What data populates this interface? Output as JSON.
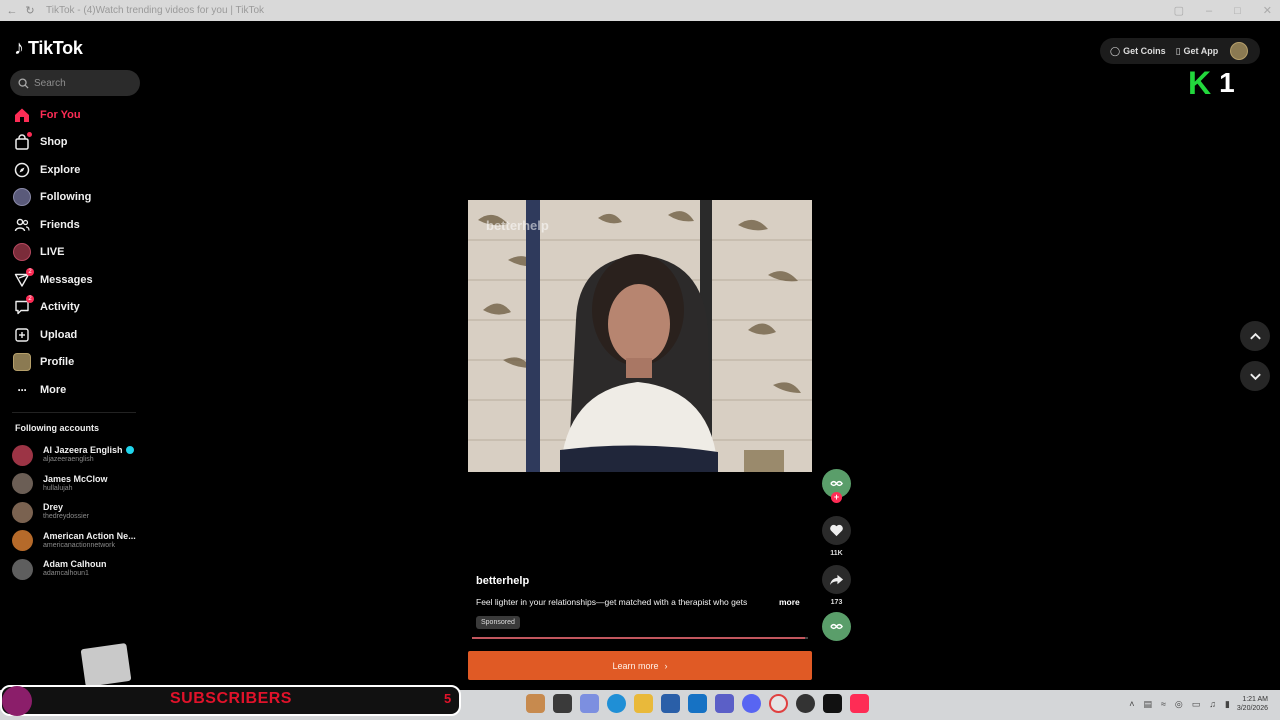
{
  "window": {
    "title": "TikTok - (4)Watch trending videos for you | TikTok"
  },
  "sidebar": {
    "logo_text": "TikTok",
    "search_placeholder": "Search",
    "items": [
      {
        "label": "For You",
        "icon": "home-icon",
        "active": true
      },
      {
        "label": "Shop",
        "icon": "shop-icon",
        "badge": ""
      },
      {
        "label": "Explore",
        "icon": "compass-icon"
      },
      {
        "label": "Following",
        "icon": "following-avatar-icon"
      },
      {
        "label": "Friends",
        "icon": "friends-icon"
      },
      {
        "label": "LIVE",
        "icon": "live-icon"
      },
      {
        "label": "Messages",
        "icon": "messages-icon",
        "badge": "2"
      },
      {
        "label": "Activity",
        "icon": "activity-icon",
        "badge": "2"
      },
      {
        "label": "Upload",
        "icon": "upload-icon"
      },
      {
        "label": "Profile",
        "icon": "profile-avatar-icon"
      },
      {
        "label": "More",
        "icon": "more-icon"
      }
    ],
    "following_header": "Following accounts",
    "accounts": [
      {
        "name": "Al Jazeera English",
        "handle": "aljazeeraenglish",
        "verified": true,
        "color": "#9c3445"
      },
      {
        "name": "James McClow",
        "handle": "hullalujah",
        "color": "#6b5e55"
      },
      {
        "name": "Drey",
        "handle": "thedreydossier",
        "color": "#7a6250"
      },
      {
        "name": "American Action Ne...",
        "handle": "americanactionnetwork",
        "color": "#b56a2a"
      },
      {
        "name": "Adam Calhoun",
        "handle": "adamcalhoun1",
        "color": "#5e5e5e"
      }
    ]
  },
  "topbar": {
    "get_coins": "Get Coins",
    "get_app": "Get App"
  },
  "overlay_counter": {
    "letter": "K",
    "number": "1"
  },
  "video": {
    "watermark": "betterhelp",
    "username": "betterhelp",
    "description": "Feel lighter in your relationships—get matched with a therapist who gets",
    "more_label": "more",
    "sponsored_label": "Sponsored",
    "cta_label": "Learn more",
    "progress": 0.99
  },
  "actions": {
    "likes": "11K",
    "shares": "173"
  },
  "stream_overlay": {
    "subscribers_label": "SUBSCRIBERS",
    "subscribers_count": "5"
  },
  "taskbar": {
    "time": "1:21 AM",
    "date": "3/20/2026"
  },
  "colors": {
    "accent": "#fe2c55",
    "cta": "#e05a25",
    "counter_green": "#22d83c"
  }
}
